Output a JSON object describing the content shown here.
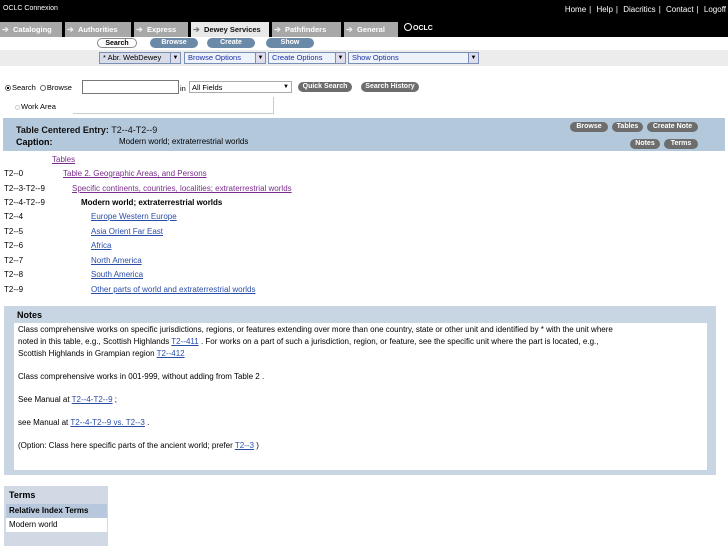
{
  "app": {
    "title": "OCLC Connexion"
  },
  "toplinks": [
    "Home",
    "Help",
    "Diacritics",
    "Contact",
    "Logoff"
  ],
  "tabs": [
    {
      "label": "Cataloging"
    },
    {
      "label": "Authorities"
    },
    {
      "label": "Express"
    },
    {
      "label": "Dewey Services",
      "active": true
    },
    {
      "label": "Pathfinders"
    },
    {
      "label": "General"
    }
  ],
  "logo": {
    "label": "OCLC"
  },
  "subtabs": [
    "Search",
    "Browse",
    "Create",
    "Show"
  ],
  "dropdowns": {
    "database": "* Abr. WebDewey",
    "browse": "Browse Options",
    "create": "Create Options",
    "show": "Show Options"
  },
  "search": {
    "radio_search": "Search",
    "radio_browse": "Browse",
    "input_value": "",
    "in_label": "in",
    "field_select": "All Fields",
    "quick_search": "Quick Search",
    "search_history": "Search History",
    "work_area_label": "Work Area"
  },
  "entry": {
    "title_label": "Table Centered Entry:",
    "title_value": "T2--4-T2--9",
    "caption_label": "Caption:",
    "caption_value": "Modern world; extraterrestrial worlds",
    "buttons": [
      "Browse",
      "Tables",
      "Create Note"
    ],
    "buttons2": [
      "Notes",
      "Terms"
    ]
  },
  "hierarchy": {
    "tables_link": "Tables",
    "table2_link": "Table 2. Geographic Areas, and Persons",
    "rows": [
      {
        "num": "T2--0",
        "label": ""
      },
      {
        "num": "T2--3-T2--9",
        "label": "Specific continents, countries, localities; extraterrestrial worlds"
      },
      {
        "num": "T2--4-T2--9",
        "label": "Modern world; extraterrestrial worlds"
      },
      {
        "num": "T2--4",
        "label": "Europe   Western Europe"
      },
      {
        "num": "T2--5",
        "label": "Asia   Orient   Far East"
      },
      {
        "num": "T2--6",
        "label": "Africa"
      },
      {
        "num": "T2--7",
        "label": "North America"
      },
      {
        "num": "T2--8",
        "label": "South America"
      },
      {
        "num": "T2--9",
        "label": "Other parts of world and extraterrestrial worlds"
      }
    ]
  },
  "notes": {
    "title": "Notes",
    "p1_line1": "Class comprehensive works on specific jurisdictions, regions, or features extending over more than one country, state or other unit and identified by * with the unit where",
    "p1_line2a": "noted in this table, e.g., Scottish Highlands",
    "p1_link1": "T2--411",
    "p1_line2b": ". For works on a part of such a jurisdiction, region, or feature, see the specific unit where the part is located, e.g.,",
    "p1_line3a": "Scottish Highlands in Grampian region",
    "p1_link2": "T2--412",
    "p2": "Class comprehensive works in 001-999, without adding from Table 2 .",
    "p3_prefix": "See Manual at",
    "p3_link": "T2--4-T2--9",
    "p3_suffix": ";",
    "p4_prefix": "see Manual at",
    "p4_link": "T2--4-T2--9 vs. T2--3",
    "p4_suffix": ".",
    "p5_prefix": "(Option: Class here specific parts of the ancient world; prefer",
    "p5_link": "T2--3",
    "p5_suffix": ")"
  },
  "terms": {
    "title": "Terms",
    "header": "Relative Index Terms",
    "rows": [
      "Modern world"
    ]
  }
}
